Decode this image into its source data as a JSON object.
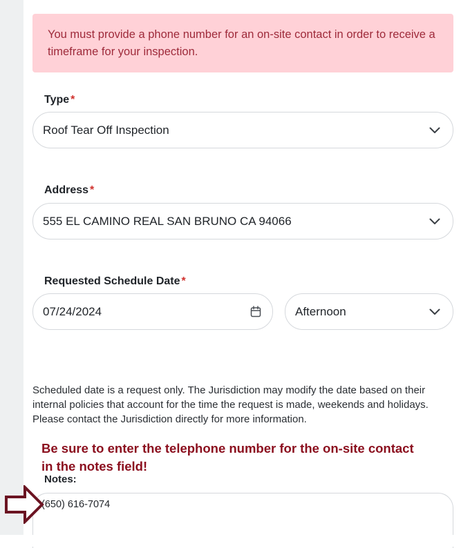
{
  "alert": {
    "message": "You must provide a phone number for an on-site contact in order to receive a timeframe for your inspection."
  },
  "type_field": {
    "label": "Type",
    "required_mark": "*",
    "value": "Roof Tear Off Inspection",
    "icon": "chevron-down-icon"
  },
  "address_field": {
    "label": "Address",
    "required_mark": "*",
    "value": "555 EL CAMINO REAL SAN BRUNO CA 94066",
    "icon": "chevron-down-icon"
  },
  "schedule": {
    "label": "Requested Schedule Date",
    "required_mark": "*",
    "date_value": "07/24/2024",
    "date_icon": "calendar-icon",
    "time_value": "Afternoon",
    "time_icon": "chevron-down-icon"
  },
  "disclaimer": "Scheduled date is a request only. The Jurisdiction may modify the date based on their internal policies that account for the time the request is made, weekends and holidays. Please contact the Jurisdiction directly for more information.",
  "callout": {
    "line1": "Be sure to enter the telephone number for the on-site contact",
    "line2": "in the notes field!",
    "color": "#8b0f1e"
  },
  "notes": {
    "label": "Notes:",
    "value": "(650) 616-7074",
    "pointer_icon": "right-arrow-icon"
  },
  "colors": {
    "alert_bg": "#ffd1d7",
    "alert_text": "#9e2a3a",
    "required": "#d0312d",
    "arrow": "#6b1422"
  }
}
